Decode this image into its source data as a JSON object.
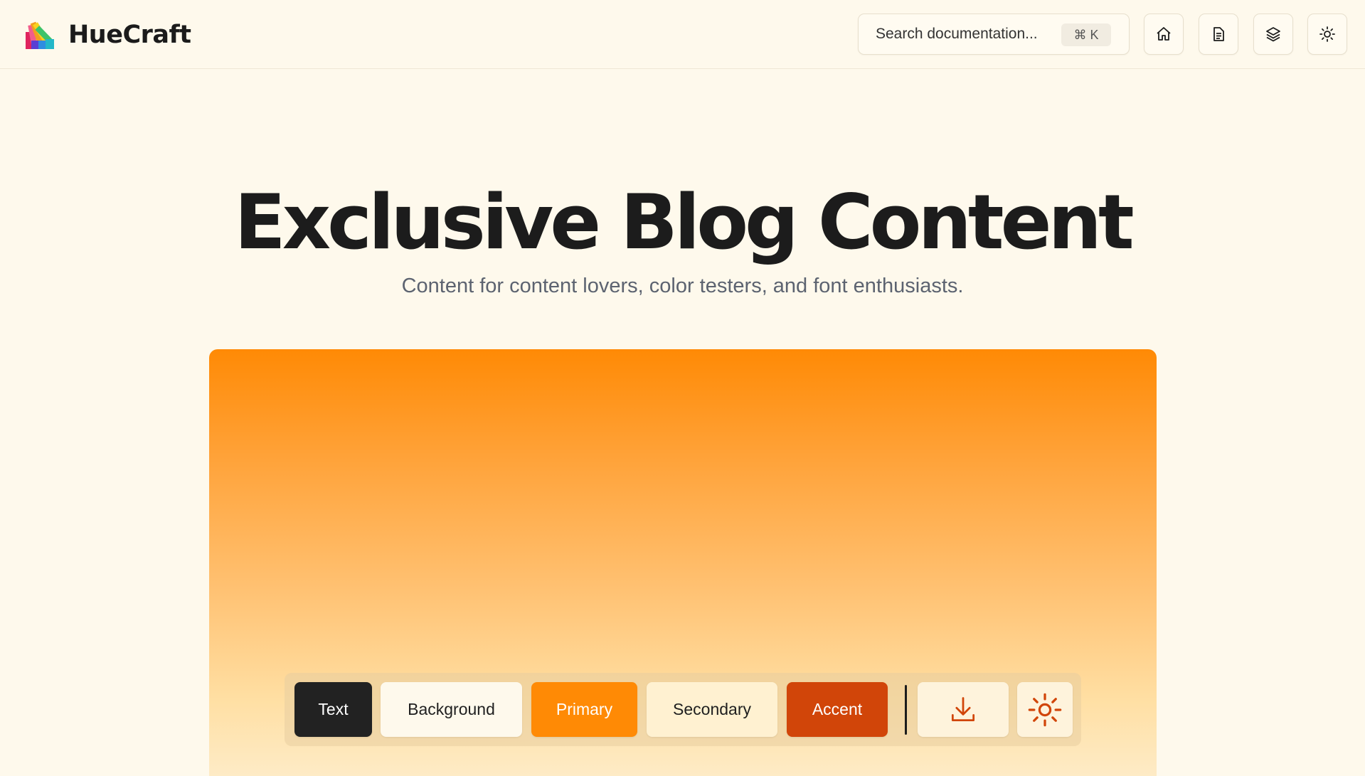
{
  "brand": {
    "name": "HueCraft"
  },
  "search": {
    "placeholder": "Search documentation...",
    "shortcut": "⌘ K"
  },
  "nav_icons": [
    "home-icon",
    "document-icon",
    "layers-icon",
    "sun-icon"
  ],
  "hero": {
    "title": "Exclusive Blog Content",
    "subtitle": "Content for content lovers, color testers, and font enthusiasts."
  },
  "palette": {
    "buttons": [
      {
        "label": "Text",
        "bg": "#222222",
        "fg": "#ffffff"
      },
      {
        "label": "Background",
        "bg": "#FEF9EC",
        "fg": "#1f1f1f"
      },
      {
        "label": "Primary",
        "bg": "#FF8A05",
        "fg": "#ffffff"
      },
      {
        "label": "Secondary",
        "bg": "#FFF1D1",
        "fg": "#1f1f1f"
      },
      {
        "label": "Accent",
        "bg": "#D14509",
        "fg": "#ffffff"
      }
    ],
    "download_icon": "download-icon",
    "theme_icon": "sun-icon"
  },
  "colors": {
    "accent": "#D14509",
    "primary": "#FF8A05",
    "background": "#FEF9EC"
  }
}
